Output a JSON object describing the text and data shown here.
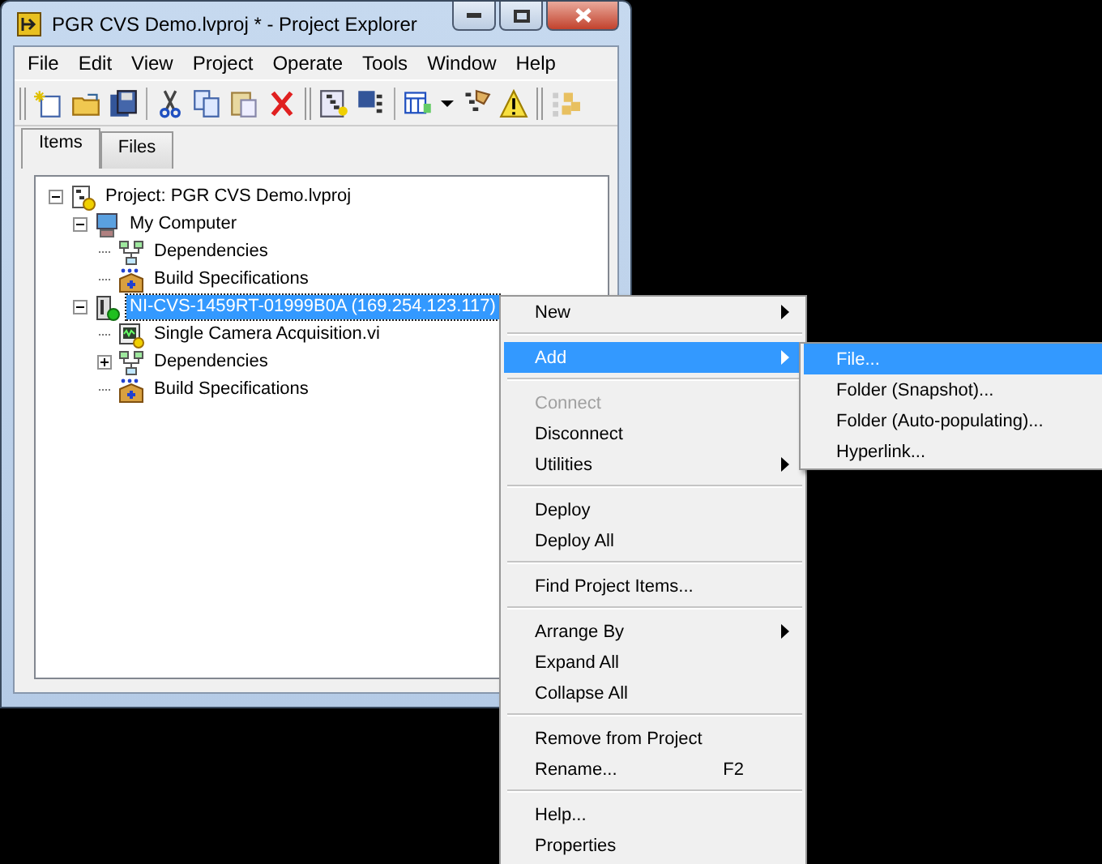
{
  "window": {
    "title": "PGR CVS Demo.lvproj * - Project Explorer"
  },
  "menu_bar": [
    "File",
    "Edit",
    "View",
    "Project",
    "Operate",
    "Tools",
    "Window",
    "Help"
  ],
  "tabs": [
    {
      "label": "Items",
      "selected": true
    },
    {
      "label": "Files",
      "selected": false
    }
  ],
  "tree": [
    {
      "label": "Project: PGR CVS Demo.lvproj",
      "kind": "project",
      "expanded": true,
      "selected": false,
      "children": [
        {
          "label": "My Computer",
          "kind": "computer",
          "expanded": true,
          "selected": false,
          "children": [
            {
              "label": "Dependencies",
              "kind": "dependencies",
              "selected": false
            },
            {
              "label": "Build Specifications",
              "kind": "build",
              "selected": false
            }
          ]
        },
        {
          "label": "NI-CVS-1459RT-01999B0A (169.254.123.117)",
          "kind": "target",
          "expanded": true,
          "selected": true,
          "children": [
            {
              "label": "Single Camera Acquisition.vi",
              "kind": "vi",
              "selected": false
            },
            {
              "label": "Dependencies",
              "kind": "dependencies",
              "expanded": false,
              "selected": false
            },
            {
              "label": "Build Specifications",
              "kind": "build",
              "selected": false
            }
          ]
        }
      ]
    }
  ],
  "context_menu": {
    "groups": [
      [
        {
          "label": "New",
          "submenu": true,
          "disabled": false,
          "selected": false
        }
      ],
      [
        {
          "label": "Add",
          "submenu": true,
          "disabled": false,
          "selected": true
        }
      ],
      [
        {
          "label": "Connect",
          "submenu": false,
          "disabled": true,
          "selected": false
        },
        {
          "label": "Disconnect",
          "submenu": false,
          "disabled": false,
          "selected": false
        },
        {
          "label": "Utilities",
          "submenu": true,
          "disabled": false,
          "selected": false
        }
      ],
      [
        {
          "label": "Deploy",
          "submenu": false,
          "disabled": false,
          "selected": false
        },
        {
          "label": "Deploy All",
          "submenu": false,
          "disabled": false,
          "selected": false
        }
      ],
      [
        {
          "label": "Find Project Items...",
          "submenu": false,
          "disabled": false,
          "selected": false
        }
      ],
      [
        {
          "label": "Arrange By",
          "submenu": true,
          "disabled": false,
          "selected": false
        },
        {
          "label": "Expand All",
          "submenu": false,
          "disabled": false,
          "selected": false
        },
        {
          "label": "Collapse All",
          "submenu": false,
          "disabled": false,
          "selected": false
        }
      ],
      [
        {
          "label": "Remove from Project",
          "submenu": false,
          "disabled": false,
          "selected": false
        },
        {
          "label": "Rename...",
          "shortcut": "F2",
          "submenu": false,
          "disabled": false,
          "selected": false
        }
      ],
      [
        {
          "label": "Help...",
          "submenu": false,
          "disabled": false,
          "selected": false
        },
        {
          "label": "Properties",
          "submenu": false,
          "disabled": false,
          "selected": false
        }
      ]
    ]
  },
  "submenu": {
    "items": [
      {
        "label": "File...",
        "selected": true
      },
      {
        "label": "Folder (Snapshot)...",
        "selected": false
      },
      {
        "label": "Folder (Auto-populating)...",
        "selected": false
      },
      {
        "label": "Hyperlink...",
        "selected": false
      }
    ]
  }
}
